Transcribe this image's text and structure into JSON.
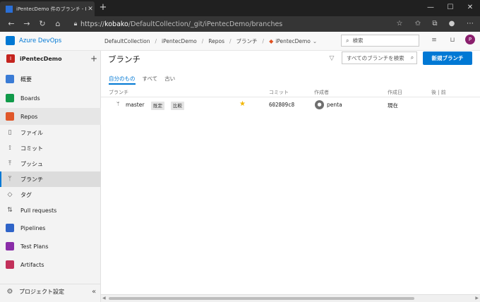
{
  "browser": {
    "tab_title": "iPentecDemo 件のブランチ - Repos",
    "url_scheme": "https://",
    "url_host": "kobako",
    "url_path": "/DefaultCollection/_git/iPentecDemo/branches"
  },
  "header": {
    "brand": "Azure DevOps",
    "breadcrumbs": [
      "DefaultCollection",
      "iPentecDemo",
      "Repos",
      "ブランチ",
      "iPentecDemo"
    ],
    "search_placeholder": "検索",
    "avatar_initial": "P"
  },
  "sidebar": {
    "project_initial": "I",
    "project_name": "iPentecDemo",
    "items": [
      {
        "label": "概要",
        "icon": "overview-icon"
      },
      {
        "label": "Boards",
        "icon": "boards-icon"
      },
      {
        "label": "Repos",
        "icon": "repos-icon"
      },
      {
        "label": "ファイル",
        "icon": "file-icon"
      },
      {
        "label": "コミット",
        "icon": "commit-icon"
      },
      {
        "label": "プッシュ",
        "icon": "push-icon"
      },
      {
        "label": "ブランチ",
        "icon": "branch-icon"
      },
      {
        "label": "タグ",
        "icon": "tag-icon"
      },
      {
        "label": "Pull requests",
        "icon": "pull-request-icon"
      },
      {
        "label": "Pipelines",
        "icon": "pipelines-icon"
      },
      {
        "label": "Test Plans",
        "icon": "test-plans-icon"
      },
      {
        "label": "Artifacts",
        "icon": "artifacts-icon"
      }
    ],
    "settings_label": "プロジェクト設定"
  },
  "main": {
    "title": "ブランチ",
    "search_placeholder": "すべてのブランチを検索",
    "new_branch_label": "新規ブランチ",
    "tabs": [
      "自分のもの",
      "すべて",
      "古い"
    ],
    "columns": [
      "ブランチ",
      "コミット",
      "作成者",
      "作成日",
      "後 | 前"
    ],
    "rows": [
      {
        "branch": "master",
        "tags": [
          "既定",
          "比較"
        ],
        "commit": "602809c8",
        "author": "penta",
        "created": "現在"
      }
    ]
  },
  "colors": {
    "accent": "#0078d4",
    "project": "#c4241f",
    "star": "#f2b600"
  }
}
